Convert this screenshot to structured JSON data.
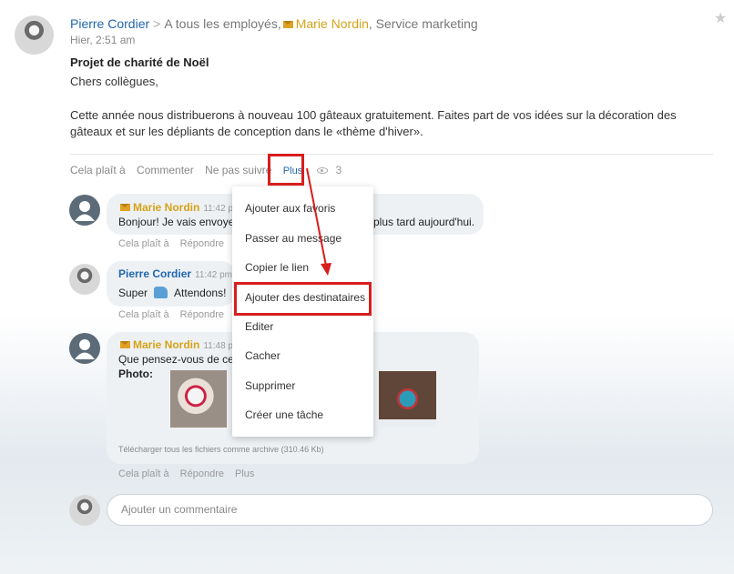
{
  "post": {
    "author": "Pierre Cordier",
    "separator": ">",
    "audience": "A tous les employés,",
    "recipient": "Marie Nordin",
    "recipient_sep": ",",
    "department": "Service marketing",
    "time": "Hier, 2:51 am",
    "title": "Projet de charité de Noël",
    "greeting": "Chers collègues,",
    "body": "Cette année nous distribuerons à nouveau 100 gâteaux gratuitement. Faites part de vos idées sur la décoration des gâteaux et sur les dépliants de conception dans le «thème d'hiver».",
    "star_icon": "star-icon"
  },
  "actions": {
    "like": "Cela plaît à",
    "comment": "Commenter",
    "unfollow": "Ne pas suivre",
    "more": "Plus",
    "views": "3"
  },
  "comments": [
    {
      "author": "Marie Nordin",
      "time": "11:42 pm",
      "text_before": "Bonjour! Je vais envoyer",
      "text_after": "plus tard aujourd'hui.",
      "like": "Cela plaît à",
      "reply": "Répondre"
    },
    {
      "author": "Pierre Cordier",
      "time": "11:42 pm",
      "text_before": "Super",
      "text_after": "Attendons!",
      "emoji": "thumbs-up",
      "like": "Cela plaît à",
      "reply": "Répondre"
    },
    {
      "author": "Marie Nordin",
      "time": "11:48 pm",
      "text": "Que pensez-vous de ces",
      "photo_label": "Photo:",
      "download": "Télécharger tous les fichiers comme archive (310.46 Kb)",
      "like": "Cela plaît à",
      "reply": "Répondre",
      "more": "Plus"
    }
  ],
  "menu": {
    "items": [
      "Ajouter aux favoris",
      "Passer au message",
      "Copier le lien",
      "Ajouter des destinataires",
      "Editer",
      "Cacher",
      "Supprimer",
      "Créer une tâche"
    ],
    "highlighted_index": 3
  },
  "comment_input": {
    "placeholder": "Ajouter un commentaire"
  },
  "colors": {
    "link_blue": "#2067b0",
    "accent_orange": "#d6a21a",
    "highlight_red": "#d81d1d"
  }
}
